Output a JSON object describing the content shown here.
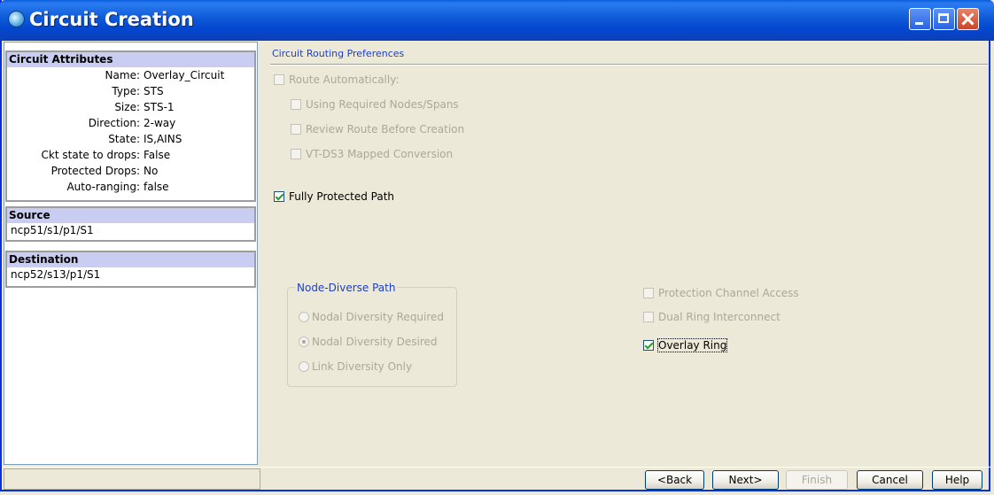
{
  "window": {
    "title": "Circuit Creation"
  },
  "attributes": {
    "header": "Circuit Attributes",
    "rows": [
      {
        "key": "Name:",
        "value": "Overlay_Circuit"
      },
      {
        "key": "Type:",
        "value": "STS"
      },
      {
        "key": "Size:",
        "value": "STS-1"
      },
      {
        "key": "Direction:",
        "value": "2-way"
      },
      {
        "key": "State:",
        "value": "IS,AINS"
      },
      {
        "key": "Ckt state to drops:",
        "value": "False"
      },
      {
        "key": "Protected Drops:",
        "value": "No"
      },
      {
        "key": "Auto-ranging:",
        "value": "false"
      }
    ]
  },
  "source": {
    "header": "Source",
    "value": "ncp51/s1/p1/S1"
  },
  "destination": {
    "header": "Destination",
    "value": "ncp52/s13/p1/S1"
  },
  "routing": {
    "section_title": "Circuit Routing Preferences",
    "route_automatically": "Route Automatically:",
    "using_required": "Using Required Nodes/Spans",
    "review_route": "Review Route Before Creation",
    "vt_ds3": "VT-DS3 Mapped Conversion",
    "fully_protected": "Fully Protected Path",
    "node_diverse": {
      "legend": "Node-Diverse Path",
      "options": [
        "Nodal Diversity Required",
        "Nodal Diversity Desired",
        "Link Diversity Only"
      ],
      "selected": "Nodal Diversity Desired"
    },
    "protection_channel": "Protection Channel Access",
    "dual_ring": "Dual Ring Interconnect",
    "overlay_ring": "Overlay Ring"
  },
  "buttons": {
    "back": "<Back",
    "next": "Next>",
    "finish": "Finish",
    "cancel": "Cancel",
    "help": "Help"
  },
  "colors": {
    "title_bar": "#0347d0",
    "group_header": "#c9cdf2",
    "section_title": "#1f3fbf",
    "check": "#21a121"
  }
}
